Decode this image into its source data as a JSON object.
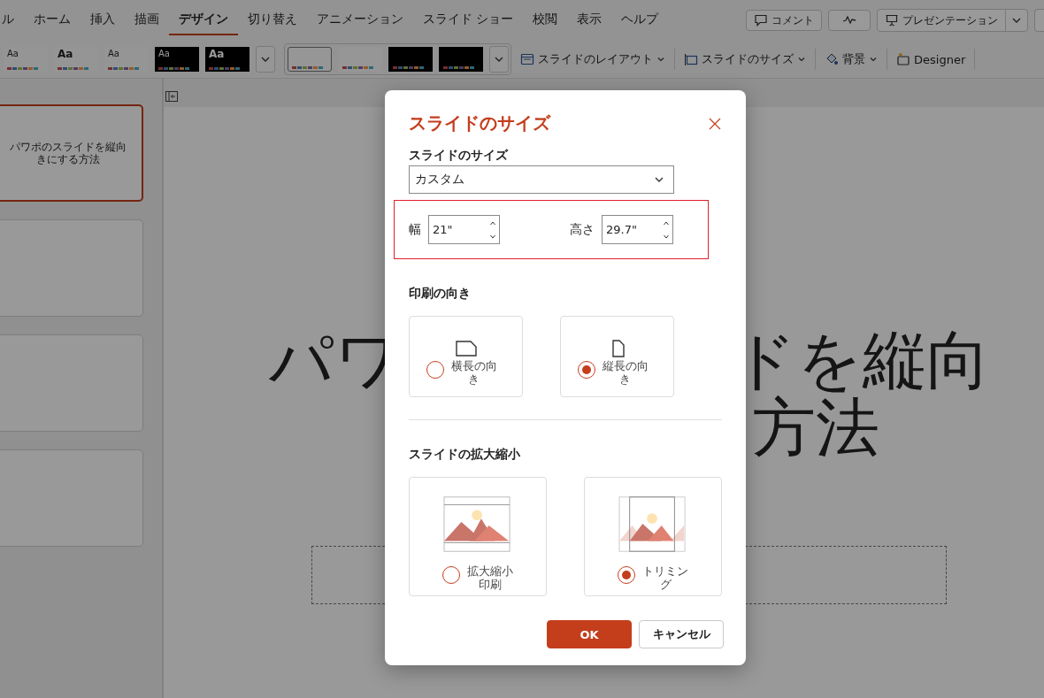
{
  "ribbon_tabs": [
    {
      "label": "ル",
      "selected": false
    },
    {
      "label": "ホーム",
      "selected": false
    },
    {
      "label": "挿入",
      "selected": false
    },
    {
      "label": "描画",
      "selected": false
    },
    {
      "label": "デザイン",
      "selected": true
    },
    {
      "label": "切り替え",
      "selected": false
    },
    {
      "label": "アニメーション",
      "selected": false
    },
    {
      "label": "スライド ショー",
      "selected": false
    },
    {
      "label": "校閲",
      "selected": false
    },
    {
      "label": "表示",
      "selected": false
    },
    {
      "label": "ヘルプ",
      "selected": false
    }
  ],
  "comment_button": "コメント",
  "present_button": "プレゼンテーション",
  "themes": [
    {
      "label": "Aa",
      "kind": "light"
    },
    {
      "label": "Aa",
      "kind": "light-bold"
    },
    {
      "label": "Aa",
      "kind": "light"
    },
    {
      "label": "Aa",
      "kind": "dark"
    },
    {
      "label": "Aa",
      "kind": "dark-bold"
    }
  ],
  "variants": [
    {
      "kind": "light",
      "selected": true
    },
    {
      "kind": "light",
      "selected": false
    },
    {
      "kind": "dark",
      "selected": false
    },
    {
      "kind": "dark",
      "selected": false
    }
  ],
  "design_commands": [
    {
      "kind": "layout",
      "label": "スライドのレイアウト",
      "dropdown": true
    },
    {
      "kind": "size",
      "label": "スライドのサイズ",
      "dropdown": true
    },
    {
      "kind": "background",
      "label": "背景",
      "dropdown": true
    },
    {
      "kind": "designer",
      "label": "Designer",
      "dropdown": false
    }
  ],
  "slides": [
    {
      "title": "パワポのスライドを縦向きにする方法",
      "selected": true
    },
    {
      "selected": false
    },
    {
      "selected": false
    },
    {
      "selected": false
    }
  ],
  "slide": {
    "title_parts": [
      "パワ",
      "ドを縦向",
      "方法"
    ]
  },
  "dialog": {
    "title": "スライドのサイズ",
    "size_label": "スライドのサイズ",
    "size_value": "カスタム",
    "width_label": "幅",
    "width_value": "21\"",
    "height_label": "高さ",
    "height_value": "29.7\"",
    "orientation_heading": "印刷の向き",
    "orientations": [
      {
        "kind": "landscape",
        "label": "横長の向き",
        "selected": false
      },
      {
        "kind": "portrait",
        "label": "縦長の向き",
        "selected": true
      }
    ],
    "scaling_heading": "スライドの拡大縮小",
    "scalings": [
      {
        "kind": "fit",
        "label": "拡大縮小印刷",
        "selected": false
      },
      {
        "kind": "crop",
        "label": "トリミング",
        "selected": true
      }
    ],
    "buttons": [
      {
        "kind": "primary",
        "label": "OK"
      },
      {
        "kind": "secondary",
        "label": "キャンセル"
      }
    ]
  }
}
